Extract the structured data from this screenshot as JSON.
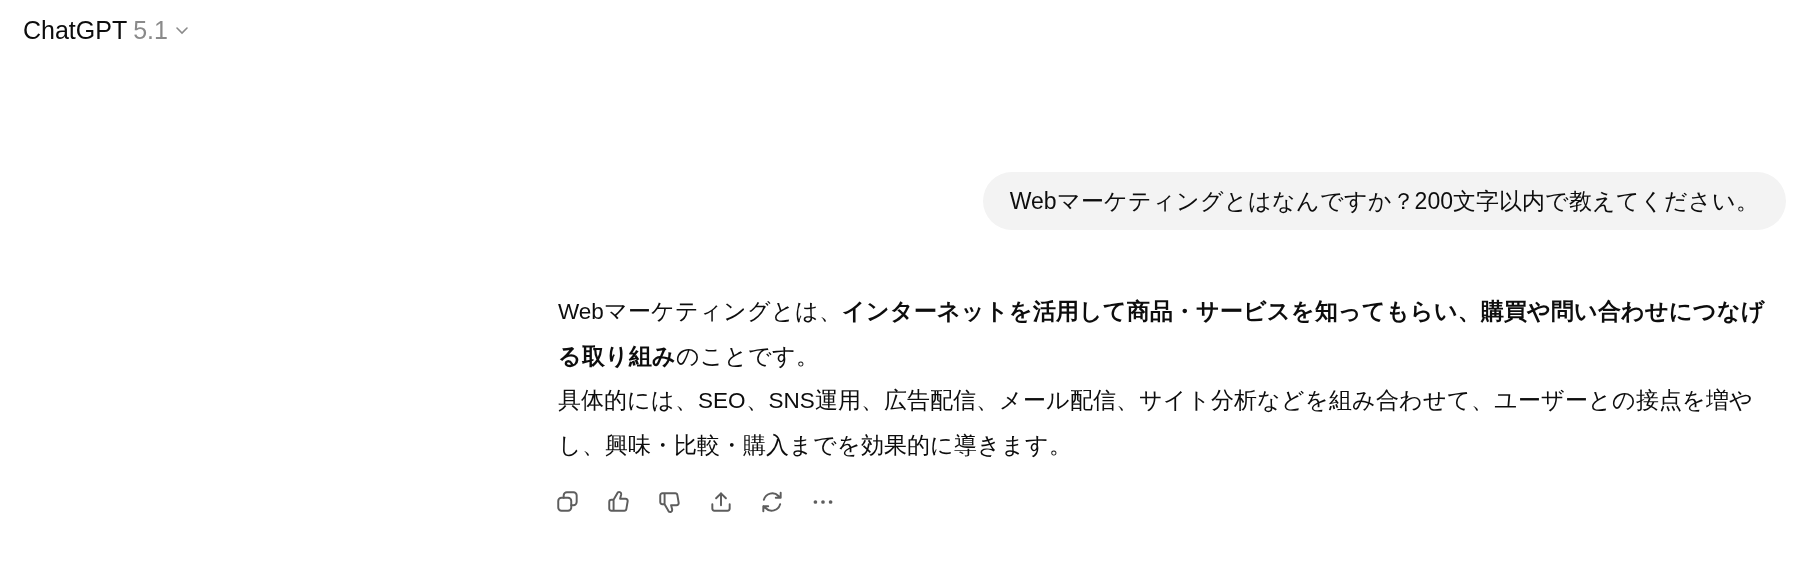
{
  "header": {
    "title": "ChatGPT",
    "version": "5.1"
  },
  "user_message": "Webマーケティングとはなんですか？200文字以内で教えてください。",
  "assistant_message": [
    "Webマーケティングとは、**インターネットを活用して商品・サービスを知ってもらい、購買や問い合わせにつなげる取り組み**のことです。",
    "具体的には、SEO、SNS運用、広告配信、メール配信、サイト分析などを組み合わせて、ユーザーとの接点を増やし、興味・比較・購入までを効果的に導きます。"
  ]
}
